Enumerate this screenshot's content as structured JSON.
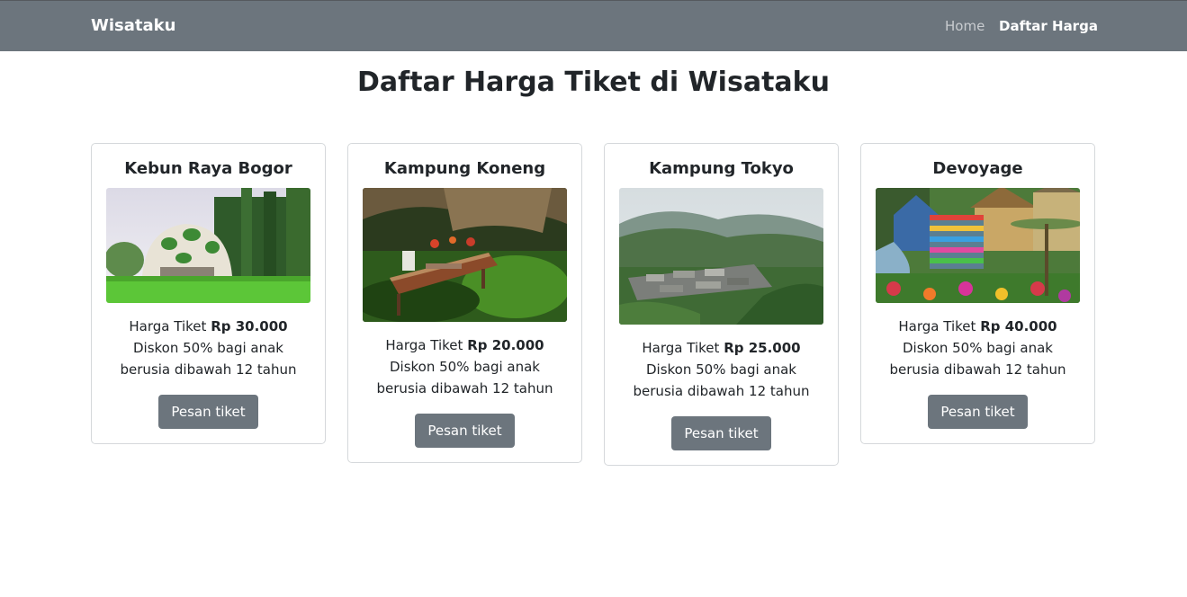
{
  "navbar": {
    "brand": "Wisataku",
    "links": [
      {
        "label": "Home",
        "active": false
      },
      {
        "label": "Daftar Harga",
        "active": true
      }
    ]
  },
  "page_title": "Daftar Harga Tiket di Wisataku",
  "cards": [
    {
      "title": "Kebun Raya Bogor",
      "price_label": "Harga Tiket",
      "price": "Rp 30.000",
      "discount": "Diskon 50% bagi anak berusia dibawah 12 tahun",
      "button": "Pesan tiket"
    },
    {
      "title": "Kampung Koneng",
      "price_label": "Harga Tiket",
      "price": "Rp 20.000",
      "discount": "Diskon 50% bagi anak berusia dibawah 12 tahun",
      "button": "Pesan tiket"
    },
    {
      "title": "Kampung Tokyo",
      "price_label": "Harga Tiket",
      "price": "Rp 25.000",
      "discount": "Diskon 50% bagi anak berusia dibawah 12 tahun",
      "button": "Pesan tiket"
    },
    {
      "title": "Devoyage",
      "price_label": "Harga Tiket",
      "price": "Rp 40.000",
      "discount": "Diskon 50% bagi anak berusia dibawah 12 tahun",
      "button": "Pesan tiket"
    }
  ],
  "colors": {
    "navbar_bg": "#6c757d",
    "button_bg": "#6c757d",
    "text": "#212529"
  }
}
